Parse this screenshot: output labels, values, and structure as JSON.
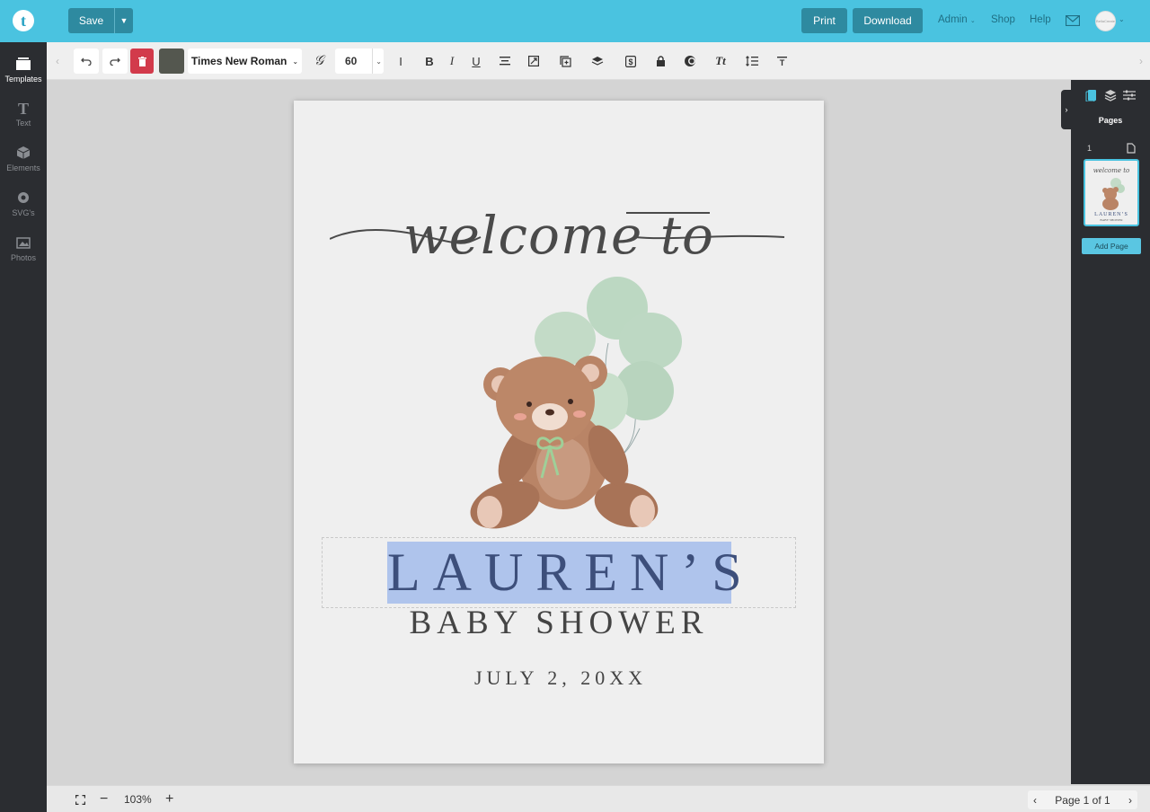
{
  "header": {
    "logo_letter": "t",
    "save_label": "Save",
    "print_label": "Print",
    "download_label": "Download",
    "links": [
      "Admin",
      "Shop",
      "Help"
    ],
    "avatar_text": "BellaCreate"
  },
  "sidebar": {
    "items": [
      {
        "label": "Templates",
        "icon": "templates-icon",
        "active": true
      },
      {
        "label": "Text",
        "icon": "text-icon",
        "active": false
      },
      {
        "label": "Elements",
        "icon": "elements-icon",
        "active": false
      },
      {
        "label": "SVG's",
        "icon": "svg-icon",
        "active": false
      },
      {
        "label": "Photos",
        "icon": "photos-icon",
        "active": false
      }
    ]
  },
  "toolbar": {
    "font_name": "Times New Roman",
    "font_size": "60",
    "color_swatch": "#54574f",
    "delete_color": "#d23a4b"
  },
  "design": {
    "welcome": "welcome to",
    "name": "LAUREN’S",
    "subtitle": "BABY SHOWER",
    "date": "JULY 2, 20XX"
  },
  "right_panel": {
    "title": "Pages",
    "page_number": "1",
    "add_page_label": "Add Page",
    "thumb_name": "LAUREN’S",
    "thumb_subtitle": "BABY SHOWER"
  },
  "footer": {
    "zoom": "103%",
    "pager": "Page 1 of 1"
  },
  "colors": {
    "accent": "#4ac3e0",
    "button": "#2e8aa0",
    "selection": "#afc4ec",
    "name_text": "#3d4f7b"
  }
}
